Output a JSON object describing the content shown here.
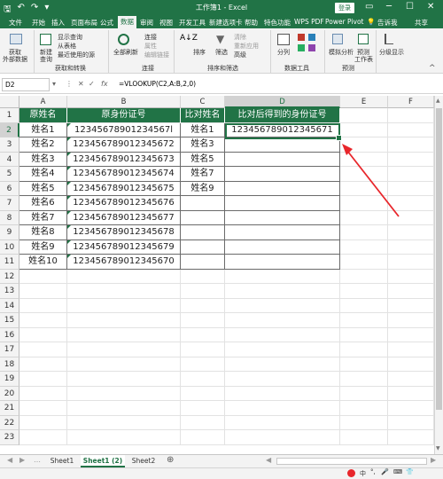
{
  "titlebar": {
    "save": "🖫",
    "undo": "↶",
    "redo": "↷",
    "title": "工作簿1 - Excel",
    "login": "登录"
  },
  "menu": [
    "文件",
    "开始",
    "插入",
    "页面布局",
    "公式",
    "数据",
    "审阅",
    "视图",
    "开发工具",
    "新建选项卡",
    "帮助",
    "特色功能",
    "WPS PDF",
    "Power Pivot",
    "告诉我",
    "共享"
  ],
  "ribbon": {
    "get_data": "获取",
    "get_data2": "外部数据",
    "new_query": "新建",
    "new_query2": "查询",
    "show_query": "显示查询",
    "from_table": "从表格",
    "recent": "最近使用的源",
    "group1": "获取和转换",
    "refresh_all": "全部刷新",
    "connections": "连接",
    "properties": "属性",
    "edit_links": "编辑链接",
    "group2": "连接",
    "sort": "排序",
    "filter": "筛选",
    "clear": "清除",
    "reapply": "重新应用",
    "advanced": "高级",
    "group3": "排序和筛选",
    "split": "分列",
    "group4": "数据工具",
    "whatif": "模拟分析",
    "forecast": "预测",
    "forecast2": "工作表",
    "group5": "预测",
    "outline": "分级显示"
  },
  "formula_bar": {
    "name_box": "D2",
    "formula": "=VLOOKUP(C2,A:B,2,0)"
  },
  "columns": [
    "A",
    "B",
    "C",
    "D",
    "E",
    "F"
  ],
  "rows": [
    "1",
    "2",
    "3",
    "4",
    "5",
    "6",
    "7",
    "8",
    "9",
    "10",
    "11",
    "12",
    "13",
    "14",
    "15",
    "16",
    "17",
    "18",
    "19",
    "20",
    "21",
    "22",
    "23"
  ],
  "table": {
    "headers": [
      "原姓名",
      "原身份证号",
      "比对姓名",
      "比对后得到的身份证号"
    ],
    "col_a": [
      "姓名1",
      "姓名2",
      "姓名3",
      "姓名4",
      "姓名5",
      "姓名6",
      "姓名7",
      "姓名8",
      "姓名9",
      "姓名10"
    ],
    "col_b": [
      "12345678901234567l",
      "123456789012345672",
      "123456789012345673",
      "123456789012345674",
      "123456789012345675",
      "123456789012345676",
      "123456789012345677",
      "123456789012345678",
      "123456789012345679",
      "123456789012345670"
    ],
    "col_c": [
      "姓名1",
      "姓名3",
      "姓名5",
      "姓名7",
      "姓名9"
    ],
    "col_d": [
      "123456789012345671"
    ]
  },
  "sheets": [
    "Sheet1",
    "Sheet1 (2)",
    "Sheet2"
  ],
  "accent": "#217346"
}
